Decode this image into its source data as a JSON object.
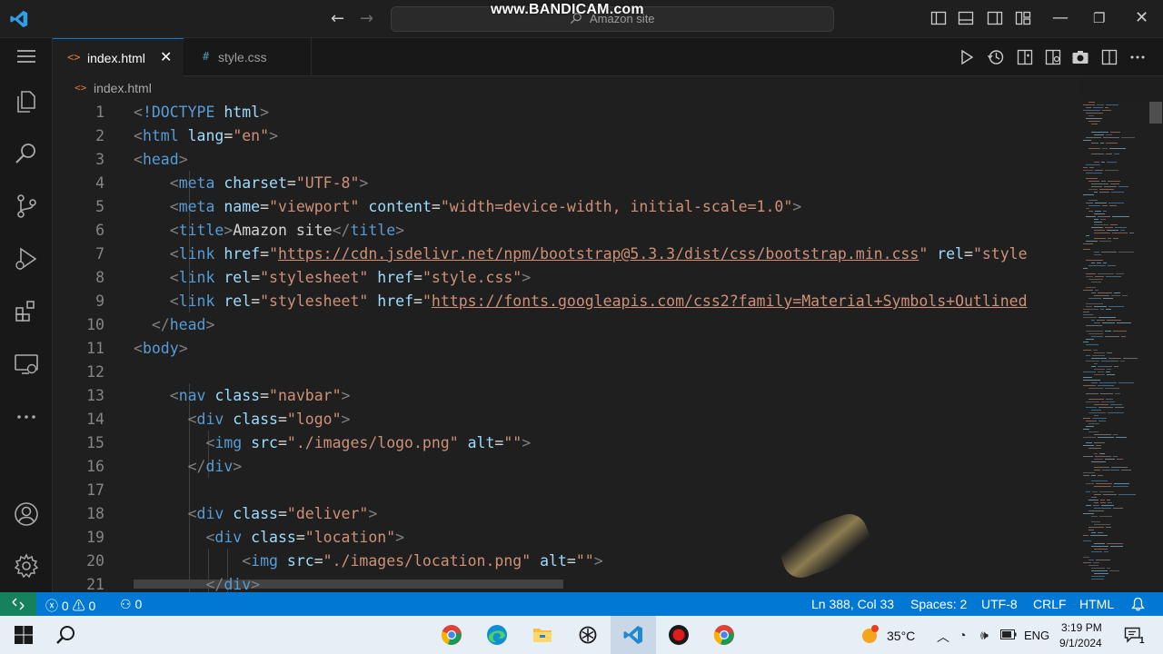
{
  "titlebar": {
    "search_text": "Amazon site",
    "watermark": "www.BANDICAM.com"
  },
  "tabs": [
    {
      "label": "index.html",
      "icon": "<>",
      "active": true
    },
    {
      "label": "style.css",
      "icon": "#",
      "active": false
    }
  ],
  "breadcrumb": {
    "icon": "<>",
    "file": "index.html"
  },
  "editor": {
    "line_numbers": [
      "1",
      "2",
      "3",
      "4",
      "5",
      "6",
      "7",
      "8",
      "9",
      "10",
      "11",
      "12",
      "13",
      "14",
      "15",
      "16",
      "17",
      "18",
      "19",
      "20",
      "21"
    ],
    "lines": [
      [
        [
          "ang",
          "<"
        ],
        [
          "tag",
          "!DOCTYPE"
        ],
        [
          "txt",
          " "
        ],
        [
          "attr",
          "html"
        ],
        [
          "ang",
          ">"
        ]
      ],
      [
        [
          "ang",
          "<"
        ],
        [
          "tag",
          "html"
        ],
        [
          "txt",
          " "
        ],
        [
          "attr",
          "lang"
        ],
        [
          "txt",
          "="
        ],
        [
          "str",
          "\"en\""
        ],
        [
          "ang",
          ">"
        ]
      ],
      [
        [
          "ang",
          "<"
        ],
        [
          "tag",
          "head"
        ],
        [
          "ang",
          ">"
        ]
      ],
      [
        [
          "txt",
          "    "
        ],
        [
          "ang",
          "<"
        ],
        [
          "tag",
          "meta"
        ],
        [
          "txt",
          " "
        ],
        [
          "attr",
          "charset"
        ],
        [
          "txt",
          "="
        ],
        [
          "str",
          "\"UTF-8\""
        ],
        [
          "ang",
          ">"
        ]
      ],
      [
        [
          "txt",
          "    "
        ],
        [
          "ang",
          "<"
        ],
        [
          "tag",
          "meta"
        ],
        [
          "txt",
          " "
        ],
        [
          "attr",
          "name"
        ],
        [
          "txt",
          "="
        ],
        [
          "str",
          "\"viewport\""
        ],
        [
          "txt",
          " "
        ],
        [
          "attr",
          "content"
        ],
        [
          "txt",
          "="
        ],
        [
          "str",
          "\"width=device-width, initial-scale=1.0\""
        ],
        [
          "ang",
          ">"
        ]
      ],
      [
        [
          "txt",
          "    "
        ],
        [
          "ang",
          "<"
        ],
        [
          "tag",
          "title"
        ],
        [
          "ang",
          ">"
        ],
        [
          "txt",
          "Amazon site"
        ],
        [
          "ang",
          "</"
        ],
        [
          "tag",
          "title"
        ],
        [
          "ang",
          ">"
        ]
      ],
      [
        [
          "txt",
          "    "
        ],
        [
          "ang",
          "<"
        ],
        [
          "tag",
          "link"
        ],
        [
          "txt",
          " "
        ],
        [
          "attr",
          "href"
        ],
        [
          "txt",
          "="
        ],
        [
          "str",
          "\""
        ],
        [
          "url",
          "https://cdn.jsdelivr.net/npm/bootstrap@5.3.3/dist/css/bootstrap.min.css"
        ],
        [
          "str",
          "\""
        ],
        [
          "txt",
          " "
        ],
        [
          "attr",
          "rel"
        ],
        [
          "txt",
          "="
        ],
        [
          "str",
          "\"style"
        ]
      ],
      [
        [
          "txt",
          "    "
        ],
        [
          "ang",
          "<"
        ],
        [
          "tag",
          "link"
        ],
        [
          "txt",
          " "
        ],
        [
          "attr",
          "rel"
        ],
        [
          "txt",
          "="
        ],
        [
          "str",
          "\"stylesheet\""
        ],
        [
          "txt",
          " "
        ],
        [
          "attr",
          "href"
        ],
        [
          "txt",
          "="
        ],
        [
          "str",
          "\"style.css\""
        ],
        [
          "ang",
          ">"
        ]
      ],
      [
        [
          "txt",
          "    "
        ],
        [
          "ang",
          "<"
        ],
        [
          "tag",
          "link"
        ],
        [
          "txt",
          " "
        ],
        [
          "attr",
          "rel"
        ],
        [
          "txt",
          "="
        ],
        [
          "str",
          "\"stylesheet\""
        ],
        [
          "txt",
          " "
        ],
        [
          "attr",
          "href"
        ],
        [
          "txt",
          "="
        ],
        [
          "str",
          "\""
        ],
        [
          "url",
          "https://fonts.googleapis.com/css2?family=Material+Symbols+Outlined"
        ]
      ],
      [
        [
          "txt",
          "  "
        ],
        [
          "ang",
          "</"
        ],
        [
          "tag",
          "head"
        ],
        [
          "ang",
          ">"
        ]
      ],
      [
        [
          "ang",
          "<"
        ],
        [
          "tag",
          "body"
        ],
        [
          "ang",
          ">"
        ]
      ],
      [],
      [
        [
          "txt",
          "    "
        ],
        [
          "ang",
          "<"
        ],
        [
          "tag",
          "nav"
        ],
        [
          "txt",
          " "
        ],
        [
          "attr",
          "class"
        ],
        [
          "txt",
          "="
        ],
        [
          "str",
          "\"navbar\""
        ],
        [
          "ang",
          ">"
        ]
      ],
      [
        [
          "txt",
          "      "
        ],
        [
          "ang",
          "<"
        ],
        [
          "tag",
          "div"
        ],
        [
          "txt",
          " "
        ],
        [
          "attr",
          "class"
        ],
        [
          "txt",
          "="
        ],
        [
          "str",
          "\"logo\""
        ],
        [
          "ang",
          ">"
        ]
      ],
      [
        [
          "txt",
          "        "
        ],
        [
          "ang",
          "<"
        ],
        [
          "tag",
          "img"
        ],
        [
          "txt",
          " "
        ],
        [
          "attr",
          "src"
        ],
        [
          "txt",
          "="
        ],
        [
          "str",
          "\"./images/logo.png\""
        ],
        [
          "txt",
          " "
        ],
        [
          "attr",
          "alt"
        ],
        [
          "txt",
          "="
        ],
        [
          "str",
          "\"\""
        ],
        [
          "ang",
          ">"
        ]
      ],
      [
        [
          "txt",
          "      "
        ],
        [
          "ang",
          "</"
        ],
        [
          "tag",
          "div"
        ],
        [
          "ang",
          ">"
        ]
      ],
      [],
      [
        [
          "txt",
          "      "
        ],
        [
          "ang",
          "<"
        ],
        [
          "tag",
          "div"
        ],
        [
          "txt",
          " "
        ],
        [
          "attr",
          "class"
        ],
        [
          "txt",
          "="
        ],
        [
          "str",
          "\"deliver\""
        ],
        [
          "ang",
          ">"
        ]
      ],
      [
        [
          "txt",
          "        "
        ],
        [
          "ang",
          "<"
        ],
        [
          "tag",
          "div"
        ],
        [
          "txt",
          " "
        ],
        [
          "attr",
          "class"
        ],
        [
          "txt",
          "="
        ],
        [
          "str",
          "\"location\""
        ],
        [
          "ang",
          ">"
        ]
      ],
      [
        [
          "txt",
          "            "
        ],
        [
          "ang",
          "<"
        ],
        [
          "tag",
          "img"
        ],
        [
          "txt",
          " "
        ],
        [
          "attr",
          "src"
        ],
        [
          "txt",
          "="
        ],
        [
          "str",
          "\"./images/location.png\""
        ],
        [
          "txt",
          " "
        ],
        [
          "attr",
          "alt"
        ],
        [
          "txt",
          "="
        ],
        [
          "str",
          "\"\""
        ],
        [
          "ang",
          ">"
        ]
      ],
      [
        [
          "txt",
          "        "
        ],
        [
          "ang",
          "</"
        ],
        [
          "tag",
          "div"
        ],
        [
          "ang",
          ">"
        ]
      ]
    ]
  },
  "statusbar": {
    "errors": "0",
    "warnings": "0",
    "ports": "0",
    "position": "Ln 388, Col 33",
    "spaces": "Spaces: 2",
    "encoding": "UTF-8",
    "eol": "CRLF",
    "language": "HTML"
  },
  "taskbar": {
    "temperature": "35°C",
    "language": "ENG",
    "time": "3:19 PM",
    "date": "9/1/2024",
    "notification_count": "1"
  },
  "colors": {
    "accent": "#0078d4",
    "remote": "#16825d",
    "tag": "#569cd6",
    "attr": "#9cdcfe",
    "string": "#ce9178"
  }
}
